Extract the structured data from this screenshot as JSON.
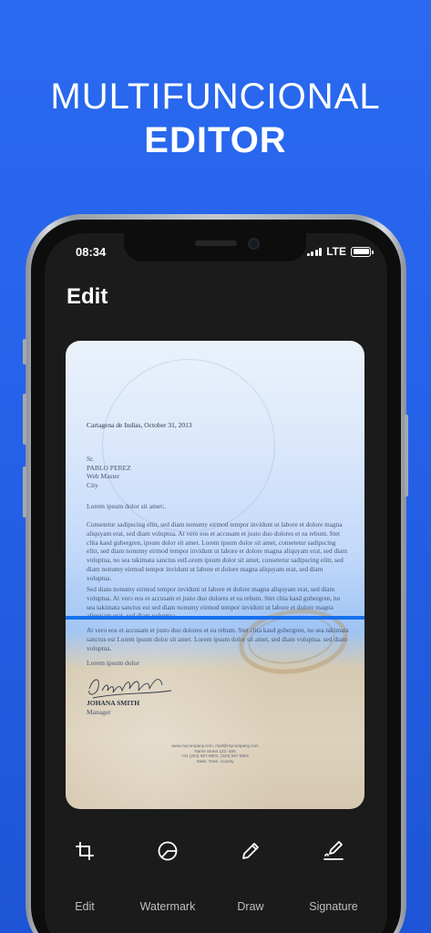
{
  "headline": {
    "line1": "MULTIFUNCIONAL",
    "line2": "EDITOR"
  },
  "status_bar": {
    "time": "08:34",
    "network": "LTE"
  },
  "screen": {
    "title": "Edit"
  },
  "document": {
    "date": "Cartagena de Indias, October 31, 2013",
    "recipient": [
      "Sr.",
      "PABLO PEREZ",
      "Web Master",
      "City"
    ],
    "greeting": "Lorem ipsum dolor sit amet:.",
    "paragraph1": "Consetetur sadipscing elitr,  sed diam nonumy eirmod tempor invidunt ut labore et dolore magna aliquyam erat, sed diam voluptua. At vero eos et accusam et justo duo dolores et ea rebum. Stet clita kasd gubergren, ipsum dolor sit amet. Lorem ipsum dolor sit amet, consetetur sadipscing elitr, sed diam nonumy eirmod tempor invidunt ut labore et dolore magna aliquyam erat, sed diam voluptua, no sea takimata sanctus estLorem ipsum dolor sit amet, consetetur sadipscing elitr, sed diam nonumy eirmod tempor invidunt ut labore et dolore magna aliquyam erat, sed diam voluptua.",
    "paragraph2": "Sed diam nonumy eirmod tempor invidunt ut labore et dolore magna aliquyam erat, sed diam voluptua. At vero eos et accusam et justo duo dolores et ea rebum. Stet clita kasd gubergren, no sea takimata sanctus est   sed diam nonumy eirmod tempor invidunt ut labore et dolore magna aliquyam erat, sed diam voluptua.",
    "paragraph3": "At vero eos et accusam et justo duo dolores et ea rebum. Stet clita kasd gubergren, no sea takimata sanctus est Lorem ipsum dolor sit amet. Lorem ipsum dolor sit amet, sed diam voluptua. sed diam voluptua.",
    "closing": "Lorem ipsum dolor",
    "signer_name": "JOHANA SMITH",
    "signer_role": "Manager",
    "footer": [
      "www.mycompany.com, mail@mycompany.com",
      "Name Street 123 -456",
      "+01 (234) 567-8901, (234) 567-8901",
      "State, Town. County"
    ]
  },
  "toolbar": [
    {
      "label": "Edit",
      "icon": "crop-icon"
    },
    {
      "label": "Watermark",
      "icon": "watermark-icon"
    },
    {
      "label": "Draw",
      "icon": "pencil-icon"
    },
    {
      "label": "Signature",
      "icon": "signature-icon"
    }
  ],
  "colors": {
    "background": "#2563ea",
    "screen": "#1b1b1c",
    "scan_line": "#1570f0"
  }
}
